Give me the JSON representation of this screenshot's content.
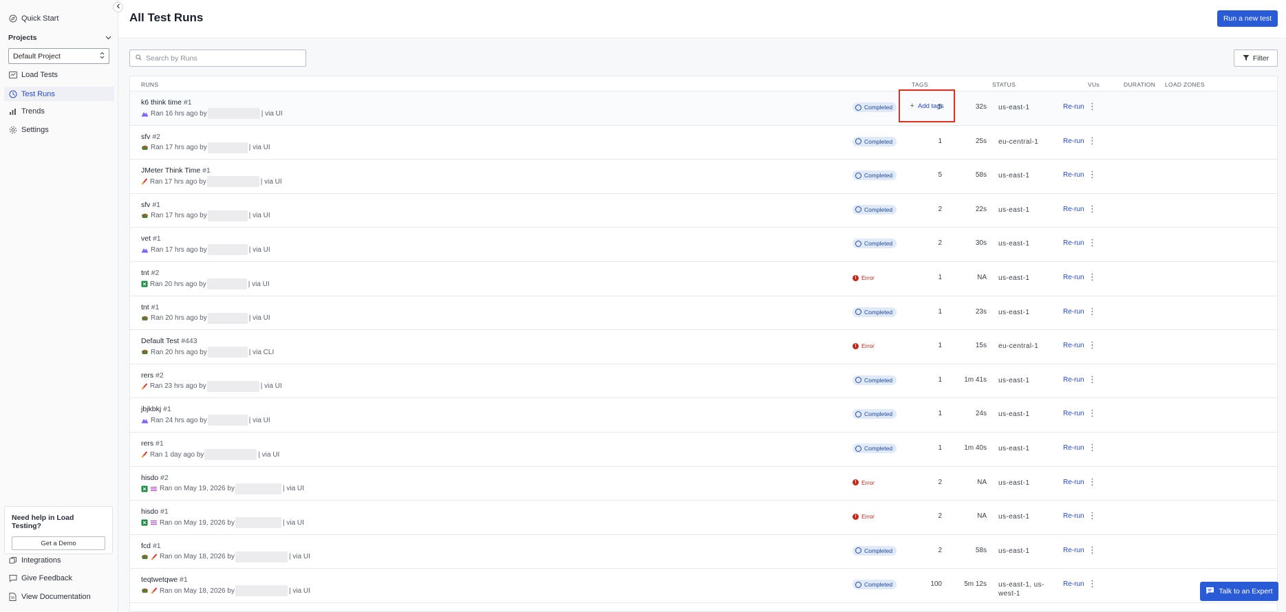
{
  "sidebar": {
    "quick_start": "Quick Start",
    "projects_label": "Projects",
    "project_selected": "Default Project",
    "items": [
      {
        "label": "Load Tests",
        "icon": "load-tests-icon"
      },
      {
        "label": "Test Runs",
        "icon": "test-runs-icon"
      },
      {
        "label": "Trends",
        "icon": "trends-icon"
      },
      {
        "label": "Settings",
        "icon": "gear-icon"
      }
    ],
    "help_title": "Need help in Load Testing?",
    "help_button": "Get a Demo",
    "bottom_items": [
      {
        "label": "Integrations"
      },
      {
        "label": "Give Feedback"
      },
      {
        "label": "View Documentation"
      }
    ]
  },
  "header": {
    "title": "All Test Runs",
    "run_button": "Run a new test"
  },
  "toolbar": {
    "search_placeholder": "Search by Runs",
    "filter_label": "Filter"
  },
  "table": {
    "columns": [
      "RUNS",
      "TAGS",
      "STATUS",
      "VUs",
      "DURATION",
      "LOAD ZONES"
    ],
    "add_tags_label": "Add tags",
    "rerun_label": "Re-run",
    "rows": [
      {
        "name": "k6 think time",
        "num": "#1",
        "ran": "Ran 16 hrs ago by",
        "via": "| via UI",
        "status": "Completed",
        "vus": "5",
        "duration": "32s",
        "zone": "us-east-1"
      },
      {
        "name": "sfv",
        "num": "#2",
        "ran": "Ran 17 hrs ago by",
        "via": "| via UI",
        "status": "Completed",
        "vus": "1",
        "duration": "25s",
        "zone": "eu-central-1"
      },
      {
        "name": "JMeter Think Time",
        "num": "#1",
        "ran": "Ran 17 hrs ago by",
        "via": "| via UI",
        "status": "Completed",
        "vus": "5",
        "duration": "58s",
        "zone": "us-east-1"
      },
      {
        "name": "sfv",
        "num": "#1",
        "ran": "Ran 17 hrs ago by",
        "via": "| via UI",
        "status": "Completed",
        "vus": "2",
        "duration": "22s",
        "zone": "us-east-1"
      },
      {
        "name": "vet",
        "num": "#1",
        "ran": "Ran 17 hrs ago by",
        "via": "| via UI",
        "status": "Completed",
        "vus": "2",
        "duration": "30s",
        "zone": "us-east-1"
      },
      {
        "name": "tnt",
        "num": "#2",
        "ran": "Ran 20 hrs ago by",
        "via": "| via UI",
        "status": "Error",
        "vus": "1",
        "duration": "NA",
        "zone": "us-east-1"
      },
      {
        "name": "tnt",
        "num": "#1",
        "ran": "Ran 20 hrs ago by",
        "via": "| via UI",
        "status": "Completed",
        "vus": "1",
        "duration": "23s",
        "zone": "us-east-1"
      },
      {
        "name": "Default Test",
        "num": "#443",
        "ran": "Ran 20 hrs ago by",
        "via": "| via CLI",
        "status": "Error",
        "vus": "1",
        "duration": "15s",
        "zone": "eu-central-1"
      },
      {
        "name": "rers",
        "num": "#2",
        "ran": "Ran 23 hrs ago by",
        "via": "| via UI",
        "status": "Completed",
        "vus": "1",
        "duration": "1m 41s",
        "zone": "us-east-1"
      },
      {
        "name": "jbjkbkj",
        "num": "#1",
        "ran": "Ran 24 hrs ago by",
        "via": "| via UI",
        "status": "Completed",
        "vus": "1",
        "duration": "24s",
        "zone": "us-east-1"
      },
      {
        "name": "rers",
        "num": "#1",
        "ran": "Ran 1 day ago by",
        "via": "| via UI",
        "status": "Completed",
        "vus": "1",
        "duration": "1m 40s",
        "zone": "us-east-1"
      },
      {
        "name": "hisdo",
        "num": "#2",
        "ran": "Ran on May 19, 2026 by",
        "via": "| via UI",
        "status": "Error",
        "vus": "2",
        "duration": "NA",
        "zone": "us-east-1"
      },
      {
        "name": "hisdo",
        "num": "#1",
        "ran": "Ran on May 19, 2026 by",
        "via": "| via UI",
        "status": "Error",
        "vus": "2",
        "duration": "NA",
        "zone": "us-east-1"
      },
      {
        "name": "fcd",
        "num": "#1",
        "ran": "Ran on May 18, 2026 by",
        "via": "| via UI",
        "status": "Completed",
        "vus": "2",
        "duration": "58s",
        "zone": "us-east-1"
      },
      {
        "name": "teqtwetqwe",
        "num": "#1",
        "ran": "Ran on May 18, 2026 by",
        "via": "| via UI",
        "status": "Completed",
        "vus": "100",
        "duration": "5m 12s",
        "zone": "us-east-1, us-",
        "zone2": "west-1"
      }
    ]
  },
  "talk_button": "Talk to an Expert",
  "colors": {
    "accent": "#2a5bd7",
    "error": "#c42a1c",
    "highlight_box": "#e0301e"
  }
}
